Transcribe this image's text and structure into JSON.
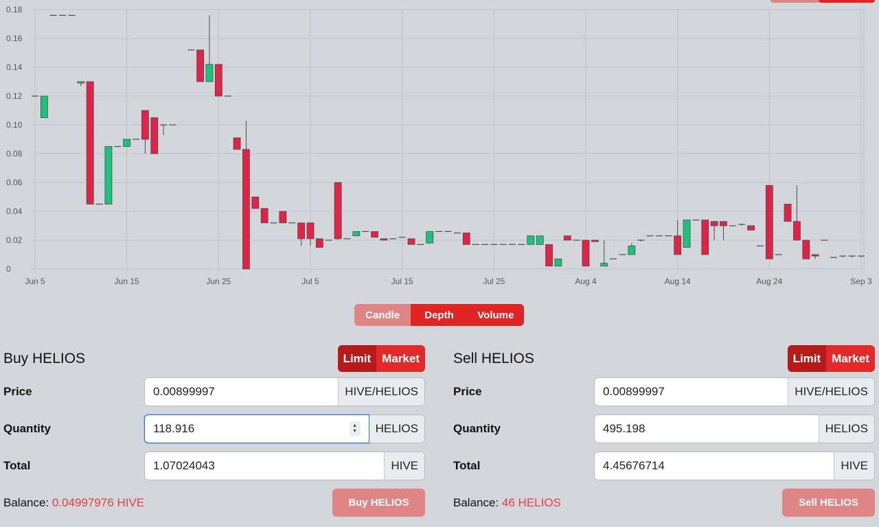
{
  "chart_data": {
    "type": "candlestick",
    "y_ticks": [
      "0.18",
      "0.16",
      "0.14",
      "0.12",
      "0.10",
      "0.08",
      "0.06",
      "0.04",
      "0.02",
      "0"
    ],
    "x_ticks": [
      "Jun 5",
      "Jun 15",
      "Jun 25",
      "Jul 5",
      "Jul 15",
      "Jul 25",
      "Aug 4",
      "Aug 14",
      "Aug 24",
      "Sep 3"
    ],
    "ylim": [
      0,
      0.18
    ],
    "x_range": [
      "Jun 5",
      "Sep 3"
    ],
    "grid": true,
    "up_color": "#1ec27a",
    "down_color": "#e02448",
    "candles": [
      {
        "date": "Jun 5",
        "o": 0.12,
        "h": 0.12,
        "l": 0.12,
        "c": 0.12
      },
      {
        "date": "Jun 6",
        "o": 0.105,
        "h": 0.12,
        "l": 0.105,
        "c": 0.12
      },
      {
        "date": "Jun 7",
        "o": 0.176,
        "h": 0.176,
        "l": 0.176,
        "c": 0.176
      },
      {
        "date": "Jun 8",
        "o": 0.176,
        "h": 0.176,
        "l": 0.176,
        "c": 0.176
      },
      {
        "date": "Jun 9",
        "o": 0.176,
        "h": 0.176,
        "l": 0.176,
        "c": 0.176
      },
      {
        "date": "Jun 10",
        "o": 0.129,
        "h": 0.13,
        "l": 0.127,
        "c": 0.13
      },
      {
        "date": "Jun 11",
        "o": 0.13,
        "h": 0.13,
        "l": 0.045,
        "c": 0.045
      },
      {
        "date": "Jun 12",
        "o": 0.045,
        "h": 0.045,
        "l": 0.045,
        "c": 0.045
      },
      {
        "date": "Jun 13",
        "o": 0.045,
        "h": 0.085,
        "l": 0.045,
        "c": 0.085
      },
      {
        "date": "Jun 14",
        "o": 0.085,
        "h": 0.085,
        "l": 0.085,
        "c": 0.085
      },
      {
        "date": "Jun 15",
        "o": 0.085,
        "h": 0.09,
        "l": 0.085,
        "c": 0.09
      },
      {
        "date": "Jun 16",
        "o": 0.09,
        "h": 0.09,
        "l": 0.09,
        "c": 0.09
      },
      {
        "date": "Jun 17",
        "o": 0.11,
        "h": 0.11,
        "l": 0.08,
        "c": 0.09
      },
      {
        "date": "Jun 18",
        "o": 0.105,
        "h": 0.105,
        "l": 0.08,
        "c": 0.08
      },
      {
        "date": "Jun 19",
        "o": 0.1,
        "h": 0.1,
        "l": 0.093,
        "c": 0.1
      },
      {
        "date": "Jun 20",
        "o": 0.1,
        "h": 0.1,
        "l": 0.1,
        "c": 0.1
      },
      {
        "date": "Jun 22",
        "o": 0.152,
        "h": 0.152,
        "l": 0.152,
        "c": 0.152
      },
      {
        "date": "Jun 23",
        "o": 0.152,
        "h": 0.152,
        "l": 0.13,
        "c": 0.13
      },
      {
        "date": "Jun 24",
        "o": 0.13,
        "h": 0.176,
        "l": 0.13,
        "c": 0.142
      },
      {
        "date": "Jun 25",
        "o": 0.142,
        "h": 0.142,
        "l": 0.12,
        "c": 0.12
      },
      {
        "date": "Jun 26",
        "o": 0.12,
        "h": 0.12,
        "l": 0.12,
        "c": 0.12
      },
      {
        "date": "Jun 27",
        "o": 0.091,
        "h": 0.091,
        "l": 0.083,
        "c": 0.083
      },
      {
        "date": "Jun 28",
        "o": 0.083,
        "h": 0.103,
        "l": 0,
        "c": 0
      },
      {
        "date": "Jun 29",
        "o": 0.05,
        "h": 0.05,
        "l": 0.042,
        "c": 0.042
      },
      {
        "date": "Jun 30",
        "o": 0.042,
        "h": 0.042,
        "l": 0.032,
        "c": 0.032
      },
      {
        "date": "Jul 1",
        "o": 0.032,
        "h": 0.032,
        "l": 0.032,
        "c": 0.032
      },
      {
        "date": "Jul 2",
        "o": 0.04,
        "h": 0.04,
        "l": 0.032,
        "c": 0.032
      },
      {
        "date": "Jul 3",
        "o": 0.032,
        "h": 0.032,
        "l": 0.032,
        "c": 0.032
      },
      {
        "date": "Jul 4",
        "o": 0.032,
        "h": 0.032,
        "l": 0.016,
        "c": 0.021
      },
      {
        "date": "Jul 5",
        "o": 0.032,
        "h": 0.032,
        "l": 0.016,
        "c": 0.021
      },
      {
        "date": "Jul 6",
        "o": 0.021,
        "h": 0.021,
        "l": 0.015,
        "c": 0.015
      },
      {
        "date": "Jul 7",
        "o": 0.02,
        "h": 0.02,
        "l": 0.02,
        "c": 0.02
      },
      {
        "date": "Jul 8",
        "o": 0.06,
        "h": 0.06,
        "l": 0.02,
        "c": 0.021
      },
      {
        "date": "Jul 9",
        "o": 0.021,
        "h": 0.021,
        "l": 0.021,
        "c": 0.021
      },
      {
        "date": "Jul 10",
        "o": 0.023,
        "h": 0.026,
        "l": 0.023,
        "c": 0.026
      },
      {
        "date": "Jul 11",
        "o": 0.026,
        "h": 0.026,
        "l": 0.026,
        "c": 0.026
      },
      {
        "date": "Jul 12",
        "o": 0.026,
        "h": 0.026,
        "l": 0.022,
        "c": 0.022
      },
      {
        "date": "Jul 13",
        "o": 0.021,
        "h": 0.021,
        "l": 0.02,
        "c": 0.02
      },
      {
        "date": "Jul 14",
        "o": 0.021,
        "h": 0.021,
        "l": 0.021,
        "c": 0.021
      },
      {
        "date": "Jul 15",
        "o": 0.022,
        "h": 0.022,
        "l": 0.022,
        "c": 0.022
      },
      {
        "date": "Jul 16",
        "o": 0.021,
        "h": 0.021,
        "l": 0.017,
        "c": 0.017
      },
      {
        "date": "Jul 17",
        "o": 0.017,
        "h": 0.017,
        "l": 0.017,
        "c": 0.017
      },
      {
        "date": "Jul 18",
        "o": 0.018,
        "h": 0.026,
        "l": 0.018,
        "c": 0.026
      },
      {
        "date": "Jul 19",
        "o": 0.026,
        "h": 0.026,
        "l": 0.026,
        "c": 0.026
      },
      {
        "date": "Jul 20",
        "o": 0.026,
        "h": 0.026,
        "l": 0.026,
        "c": 0.026
      },
      {
        "date": "Jul 21",
        "o": 0.025,
        "h": 0.025,
        "l": 0.025,
        "c": 0.025
      },
      {
        "date": "Jul 22",
        "o": 0.025,
        "h": 0.025,
        "l": 0.017,
        "c": 0.017
      },
      {
        "date": "Jul 23",
        "o": 0.017,
        "h": 0.017,
        "l": 0.017,
        "c": 0.017
      },
      {
        "date": "Jul 24",
        "o": 0.017,
        "h": 0.017,
        "l": 0.017,
        "c": 0.017
      },
      {
        "date": "Jul 25",
        "o": 0.017,
        "h": 0.017,
        "l": 0.017,
        "c": 0.017
      },
      {
        "date": "Jul 26",
        "o": 0.017,
        "h": 0.017,
        "l": 0.017,
        "c": 0.017
      },
      {
        "date": "Jul 27",
        "o": 0.017,
        "h": 0.017,
        "l": 0.017,
        "c": 0.017
      },
      {
        "date": "Jul 28",
        "o": 0.017,
        "h": 0.017,
        "l": 0.017,
        "c": 0.017
      },
      {
        "date": "Jul 29",
        "o": 0.017,
        "h": 0.023,
        "l": 0.017,
        "c": 0.023
      },
      {
        "date": "Jul 30",
        "o": 0.017,
        "h": 0.023,
        "l": 0.017,
        "c": 0.023
      },
      {
        "date": "Jul 31",
        "o": 0.017,
        "h": 0.017,
        "l": 0.002,
        "c": 0.002
      },
      {
        "date": "Aug 1",
        "o": 0.002,
        "h": 0.007,
        "l": 0.002,
        "c": 0.007
      },
      {
        "date": "Aug 2",
        "o": 0.023,
        "h": 0.023,
        "l": 0.02,
        "c": 0.02
      },
      {
        "date": "Aug 3",
        "o": 0.02,
        "h": 0.02,
        "l": 0.02,
        "c": 0.02
      },
      {
        "date": "Aug 4",
        "o": 0.02,
        "h": 0.02,
        "l": 0.002,
        "c": 0.002
      },
      {
        "date": "Aug 5",
        "o": 0.02,
        "h": 0.02,
        "l": 0.019,
        "c": 0.019
      },
      {
        "date": "Aug 6",
        "o": 0.002,
        "h": 0.02,
        "l": 0.002,
        "c": 0.004
      },
      {
        "date": "Aug 7",
        "o": 0.007,
        "h": 0.007,
        "l": 0.007,
        "c": 0.007
      },
      {
        "date": "Aug 8",
        "o": 0.01,
        "h": 0.01,
        "l": 0.01,
        "c": 0.01
      },
      {
        "date": "Aug 9",
        "o": 0.01,
        "h": 0.018,
        "l": 0.01,
        "c": 0.016
      },
      {
        "date": "Aug 10",
        "o": 0.02,
        "h": 0.02,
        "l": 0.019,
        "c": 0.02
      },
      {
        "date": "Aug 11",
        "o": 0.023,
        "h": 0.023,
        "l": 0.023,
        "c": 0.023
      },
      {
        "date": "Aug 12",
        "o": 0.023,
        "h": 0.023,
        "l": 0.023,
        "c": 0.023
      },
      {
        "date": "Aug 13",
        "o": 0.023,
        "h": 0.023,
        "l": 0.023,
        "c": 0.023
      },
      {
        "date": "Aug 14",
        "o": 0.023,
        "h": 0.034,
        "l": 0.01,
        "c": 0.01
      },
      {
        "date": "Aug 15",
        "o": 0.015,
        "h": 0.034,
        "l": 0.015,
        "c": 0.034
      },
      {
        "date": "Aug 16",
        "o": 0.034,
        "h": 0.034,
        "l": 0.034,
        "c": 0.034
      },
      {
        "date": "Aug 17",
        "o": 0.034,
        "h": 0.034,
        "l": 0.01,
        "c": 0.01
      },
      {
        "date": "Aug 18",
        "o": 0.033,
        "h": 0.033,
        "l": 0.02,
        "c": 0.03
      },
      {
        "date": "Aug 19",
        "o": 0.033,
        "h": 0.033,
        "l": 0.02,
        "c": 0.03
      },
      {
        "date": "Aug 20",
        "o": 0.03,
        "h": 0.03,
        "l": 0.03,
        "c": 0.03
      },
      {
        "date": "Aug 21",
        "o": 0.031,
        "h": 0.031,
        "l": 0.03,
        "c": 0.031
      },
      {
        "date": "Aug 22",
        "o": 0.03,
        "h": 0.03,
        "l": 0.027,
        "c": 0.027
      },
      {
        "date": "Aug 23",
        "o": 0.016,
        "h": 0.016,
        "l": 0.016,
        "c": 0.016
      },
      {
        "date": "Aug 24",
        "o": 0.058,
        "h": 0.058,
        "l": 0.007,
        "c": 0.007
      },
      {
        "date": "Aug 25",
        "o": 0.01,
        "h": 0.01,
        "l": 0.01,
        "c": 0.01
      },
      {
        "date": "Aug 26",
        "o": 0.045,
        "h": 0.045,
        "l": 0.033,
        "c": 0.033
      },
      {
        "date": "Aug 27",
        "o": 0.033,
        "h": 0.058,
        "l": 0.02,
        "c": 0.02
      },
      {
        "date": "Aug 28",
        "o": 0.02,
        "h": 0.02,
        "l": 0.007,
        "c": 0.007
      },
      {
        "date": "Aug 29",
        "o": 0.01,
        "h": 0.01,
        "l": 0.007,
        "c": 0.009
      },
      {
        "date": "Aug 30",
        "o": 0.02,
        "h": 0.02,
        "l": 0.02,
        "c": 0.02
      },
      {
        "date": "Aug 31",
        "o": 0.008,
        "h": 0.008,
        "l": 0.008,
        "c": 0.008
      },
      {
        "date": "Sep 1",
        "o": 0.009,
        "h": 0.009,
        "l": 0.008,
        "c": 0.009
      },
      {
        "date": "Sep 2",
        "o": 0.009,
        "h": 0.009,
        "l": 0.008,
        "c": 0.009
      },
      {
        "date": "Sep 3",
        "o": 0.009,
        "h": 0.009,
        "l": 0.008,
        "c": 0.009
      }
    ]
  },
  "chart_tabs": [
    {
      "label": "Candle",
      "active": true
    },
    {
      "label": "Depth",
      "active": false
    },
    {
      "label": "Volume",
      "active": false
    }
  ],
  "buy": {
    "title": "Buy HELIOS",
    "order_types": {
      "limit": "Limit",
      "market": "Market"
    },
    "price": {
      "label": "Price",
      "value": "0.00899997",
      "unit": "HIVE/HELIOS"
    },
    "quantity": {
      "label": "Quantity",
      "value": "118.916",
      "unit": "HELIOS"
    },
    "total": {
      "label": "Total",
      "value": "1.07024043",
      "unit": "HIVE"
    },
    "balance_label": "Balance:",
    "balance_value": "0.04997976 HIVE",
    "button": "Buy HELIOS"
  },
  "sell": {
    "title": "Sell HELIOS",
    "order_types": {
      "limit": "Limit",
      "market": "Market"
    },
    "price": {
      "label": "Price",
      "value": "0.00899997",
      "unit": "HIVE/HELIOS"
    },
    "quantity": {
      "label": "Quantity",
      "value": "495.198",
      "unit": "HELIOS"
    },
    "total": {
      "label": "Total",
      "value": "4.45676714",
      "unit": "HIVE"
    },
    "balance_label": "Balance:",
    "balance_value": "46 HELIOS",
    "button": "Sell HELIOS"
  },
  "colors": {
    "accent": "#e02424",
    "accent_dark": "#b51b1b",
    "accent_light": "#e08585",
    "balance_text": "#e23e3e",
    "background": "#d3d6db"
  }
}
